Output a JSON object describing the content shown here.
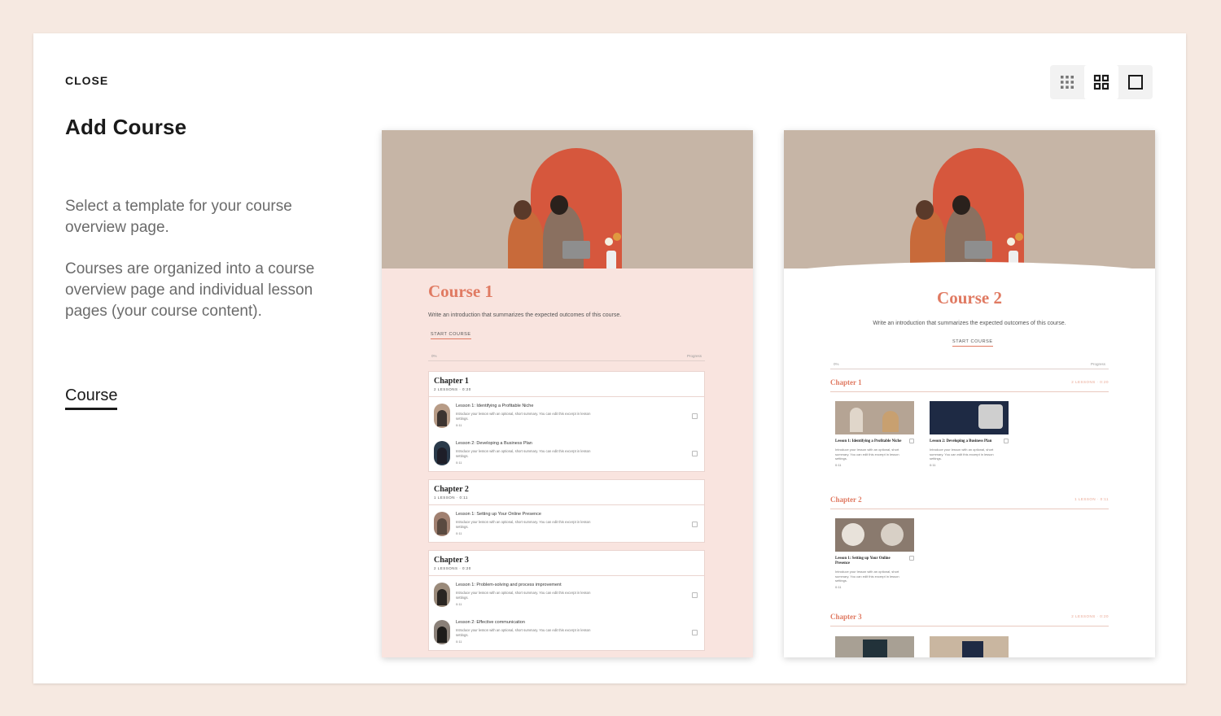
{
  "header": {
    "close_label": "CLOSE",
    "title": "Add Course"
  },
  "sidebar": {
    "description_1": "Select a template for your course overview page.",
    "description_2": "Courses are organized into a course overview page and individual lesson pages (your course content).",
    "tab_label": "Course"
  },
  "view_toggle": {
    "options": [
      "small-grid",
      "medium-grid",
      "single"
    ],
    "selected": "medium-grid"
  },
  "templates": [
    {
      "title": "Course 1",
      "intro": "Write an introduction that summarizes the expected outcomes of this course.",
      "start_label": "START COURSE",
      "progress_left": "0%",
      "progress_right": "Progress",
      "chapters": [
        {
          "name": "Chapter 1",
          "meta": "2 LESSONS · 0:20",
          "lessons": [
            {
              "title": "Lesson 1: Identifying a Profitable Niche",
              "desc": "Introduce your lesson with an optional, short summary. You can edit this excerpt in lesson settings.",
              "time": "0:11"
            },
            {
              "title": "Lesson 2: Developing a Business Plan",
              "desc": "Introduce your lesson with an optional, short summary. You can edit this excerpt in lesson settings.",
              "time": "0:11"
            }
          ]
        },
        {
          "name": "Chapter 2",
          "meta": "1 LESSON · 0:11",
          "lessons": [
            {
              "title": "Lesson 1: Setting up Your Online Presence",
              "desc": "Introduce your lesson with an optional, short summary. You can edit this excerpt in lesson settings.",
              "time": "0:11"
            }
          ]
        },
        {
          "name": "Chapter 3",
          "meta": "2 LESSONS · 0:20",
          "lessons": [
            {
              "title": "Lesson 1: Problem-solving and process improvement",
              "desc": "Introduce your lesson with an optional, short summary. You can edit this excerpt in lesson settings.",
              "time": "0:11"
            },
            {
              "title": "Lesson 2: Effective communication",
              "desc": "Introduce your lesson with an optional, short summary. You can edit this excerpt in lesson settings.",
              "time": "0:11"
            }
          ]
        }
      ]
    },
    {
      "title": "Course 2",
      "intro": "Write an introduction that summarizes the expected outcomes of this course.",
      "start_label": "START COURSE",
      "progress_left": "0%",
      "progress_right": "Progress",
      "chapters": [
        {
          "name": "Chapter 1",
          "meta": "2 LESSONS · 0:20",
          "lessons": [
            {
              "title": "Lesson 1: Identifying a Profitable Niche",
              "desc": "Introduce your lesson with an optional, short summary. You can edit this excerpt in lesson settings.",
              "time": "0:11"
            },
            {
              "title": "Lesson 2: Developing a Business Plan",
              "desc": "Introduce your lesson with an optional, short summary. You can edit this excerpt in lesson settings.",
              "time": "0:11"
            }
          ]
        },
        {
          "name": "Chapter 2",
          "meta": "1 LESSON · 0:11",
          "lessons": [
            {
              "title": "Lesson 1: Setting up Your Online Presence",
              "desc": "Introduce your lesson with an optional, short summary. You can edit this excerpt in lesson settings.",
              "time": "0:11"
            }
          ]
        },
        {
          "name": "Chapter 3",
          "meta": "2 LESSONS · 0:20"
        }
      ]
    }
  ],
  "colors": {
    "page_bg": "#f6e9e1",
    "accent": "#e07a62",
    "arch": "#d6573d",
    "card1_bg": "#f9e4df"
  }
}
